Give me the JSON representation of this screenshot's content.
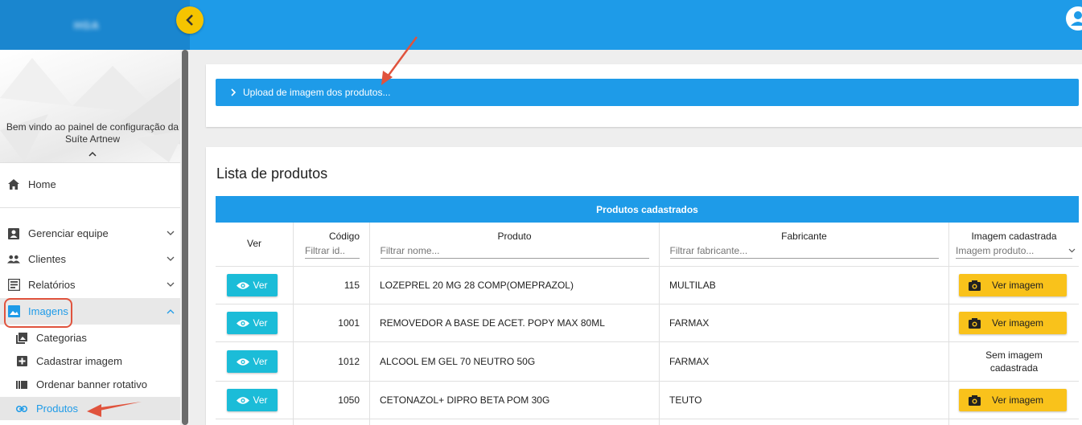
{
  "header": {
    "logo_text": "HGA"
  },
  "sidebar": {
    "welcome_line1": "Bem vindo ao painel de configuração da",
    "welcome_line2": "Suíte Artnew",
    "items": [
      {
        "label": "Home"
      },
      {
        "label": "Gerenciar equipe"
      },
      {
        "label": "Clientes"
      },
      {
        "label": "Relatórios"
      },
      {
        "label": "Imagens"
      }
    ],
    "sub_items": [
      {
        "label": "Categorias"
      },
      {
        "label": "Cadastrar imagem"
      },
      {
        "label": "Ordenar banner rotativo"
      },
      {
        "label": "Produtos"
      }
    ]
  },
  "upload": {
    "label": "Upload de imagem dos produtos..."
  },
  "list": {
    "title": "Lista de produtos",
    "caption": "Produtos cadastrados",
    "columns": {
      "ver": "Ver",
      "codigo": "Código",
      "produto": "Produto",
      "fabricante": "Fabricante",
      "imagem": "Imagem cadastrada"
    },
    "filters": {
      "codigo": "Filtrar id..",
      "produto": "Filtrar nome...",
      "fabricante": "Filtrar fabricante...",
      "imagem": "Imagem produto..."
    },
    "ver_label": "Ver",
    "ver_imagem_label": "Ver imagem",
    "rows": [
      {
        "codigo": "115",
        "produto": "LOZEPREL 20 MG 28 COMP(OMEPRAZOL)",
        "fabricante": "MULTILAB",
        "imagem": "Ver imagem"
      },
      {
        "codigo": "1001",
        "produto": "REMOVEDOR A BASE DE ACET. POPY MAX 80ML",
        "fabricante": "FARMAX",
        "imagem": "Ver imagem"
      },
      {
        "codigo": "1012",
        "produto": "ALCOOL EM GEL 70 NEUTRO 50G",
        "fabricante": "FARMAX",
        "imagem_line1": "Sem imagem",
        "imagem_line2": "cadastrada"
      },
      {
        "codigo": "1050",
        "produto": "CETONAZOL+ DIPRO BETA POM 30G",
        "fabricante": "TEUTO",
        "imagem": "Ver imagem"
      }
    ]
  },
  "colors": {
    "primary": "#1e9be8",
    "accent_yellow": "#f9c21b",
    "ver_button": "#1bbcd8",
    "annotation_red": "#e0533d"
  }
}
